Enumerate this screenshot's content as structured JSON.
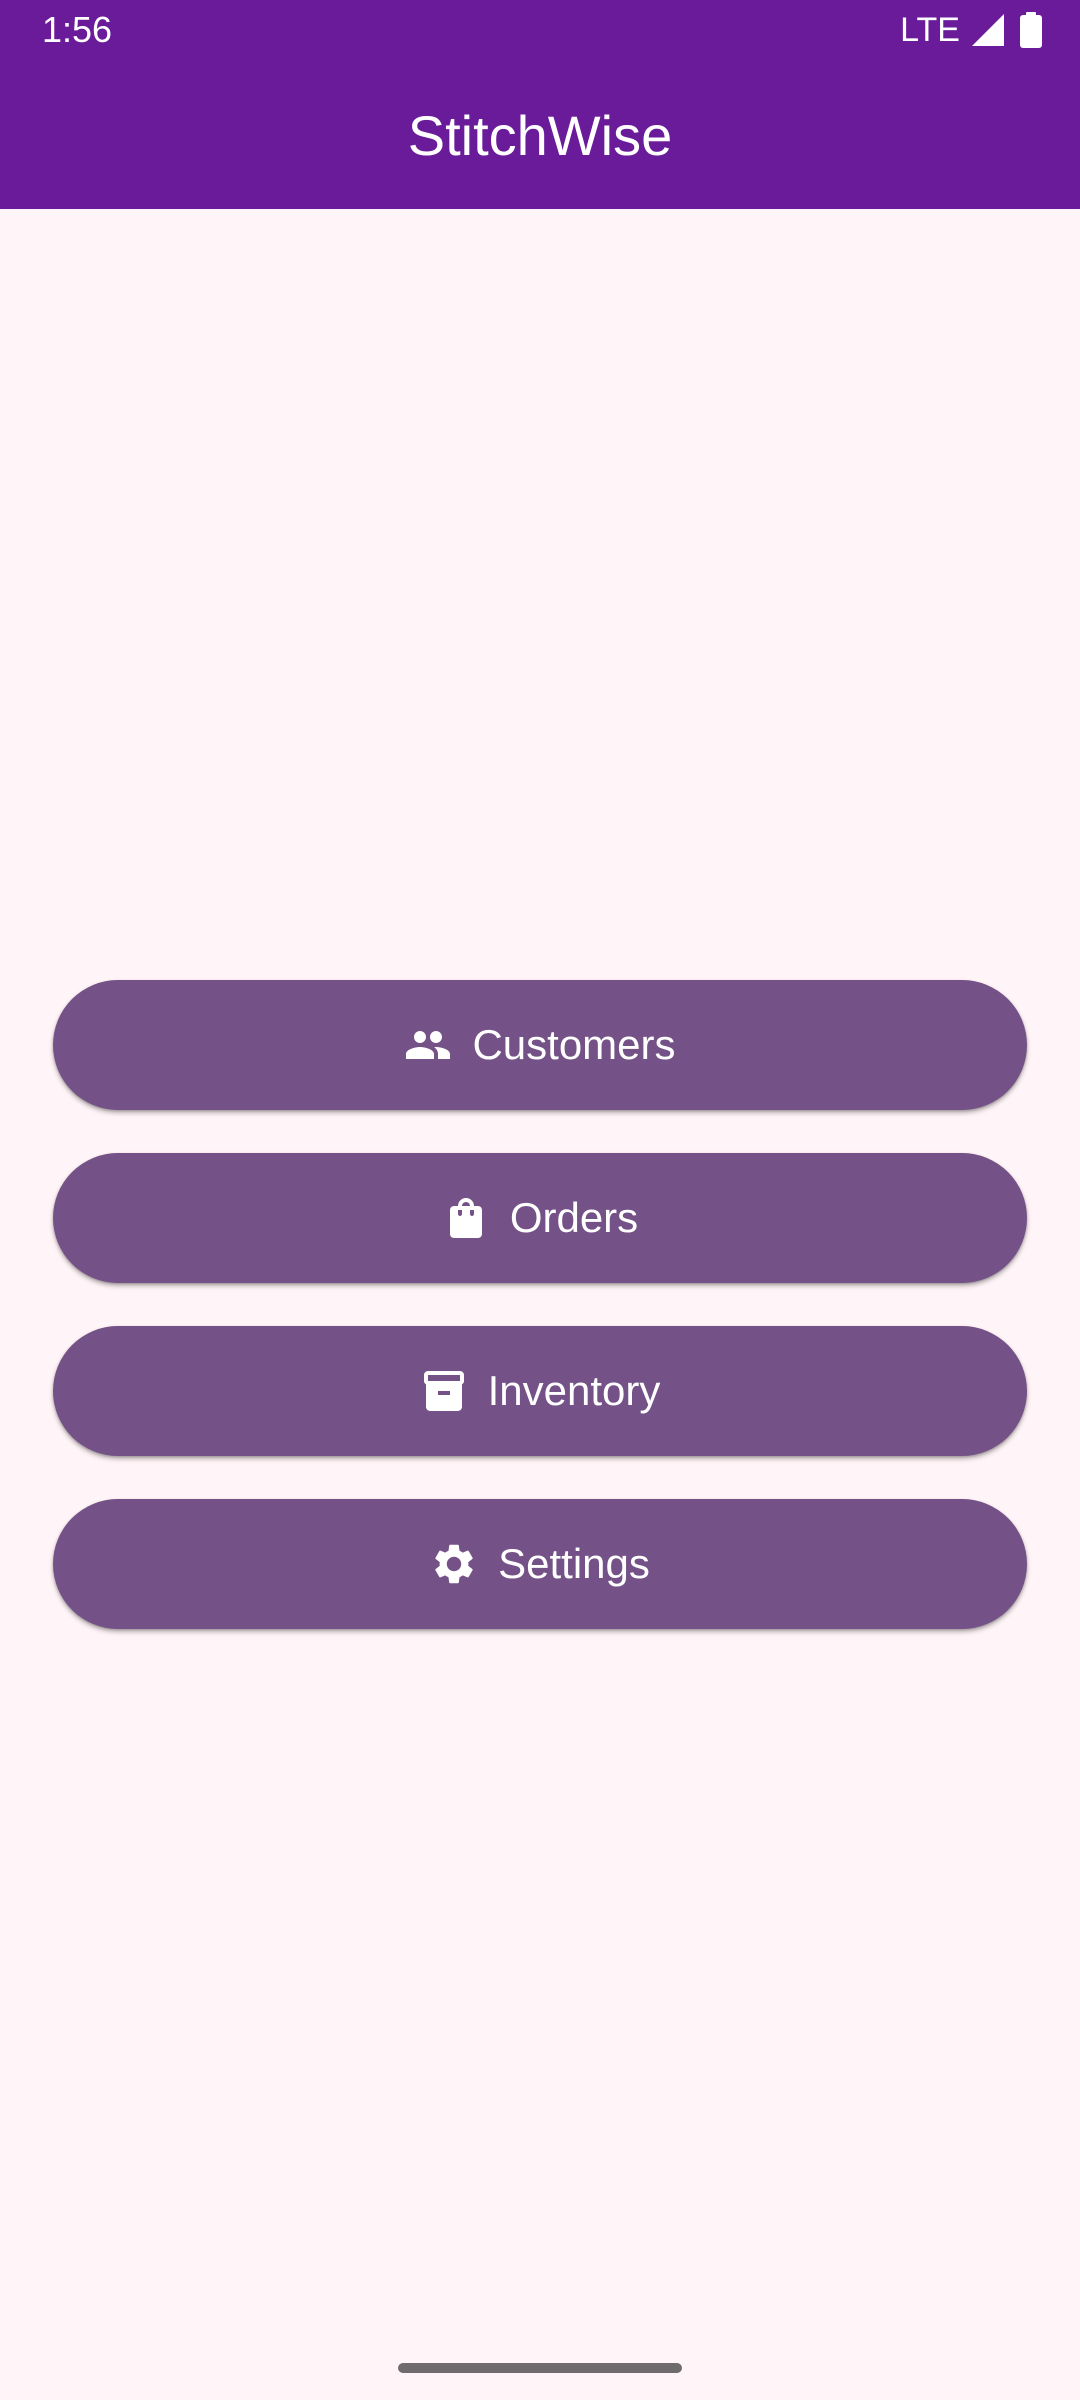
{
  "status_bar": {
    "time": "1:56",
    "network": "LTE",
    "icons": [
      "signal-icon",
      "battery-icon"
    ]
  },
  "app_bar": {
    "title": "StitchWise",
    "color": "#6A1B9A"
  },
  "menu": {
    "button_color": "#745187",
    "items": [
      {
        "label": "Customers",
        "icon": "people-icon"
      },
      {
        "label": "Orders",
        "icon": "shopping-bag-icon"
      },
      {
        "label": "Inventory",
        "icon": "archive-box-icon"
      },
      {
        "label": "Settings",
        "icon": "gear-icon"
      }
    ]
  },
  "colors": {
    "background": "#FFF4F7",
    "text_on_primary": "#FFFFFF"
  }
}
